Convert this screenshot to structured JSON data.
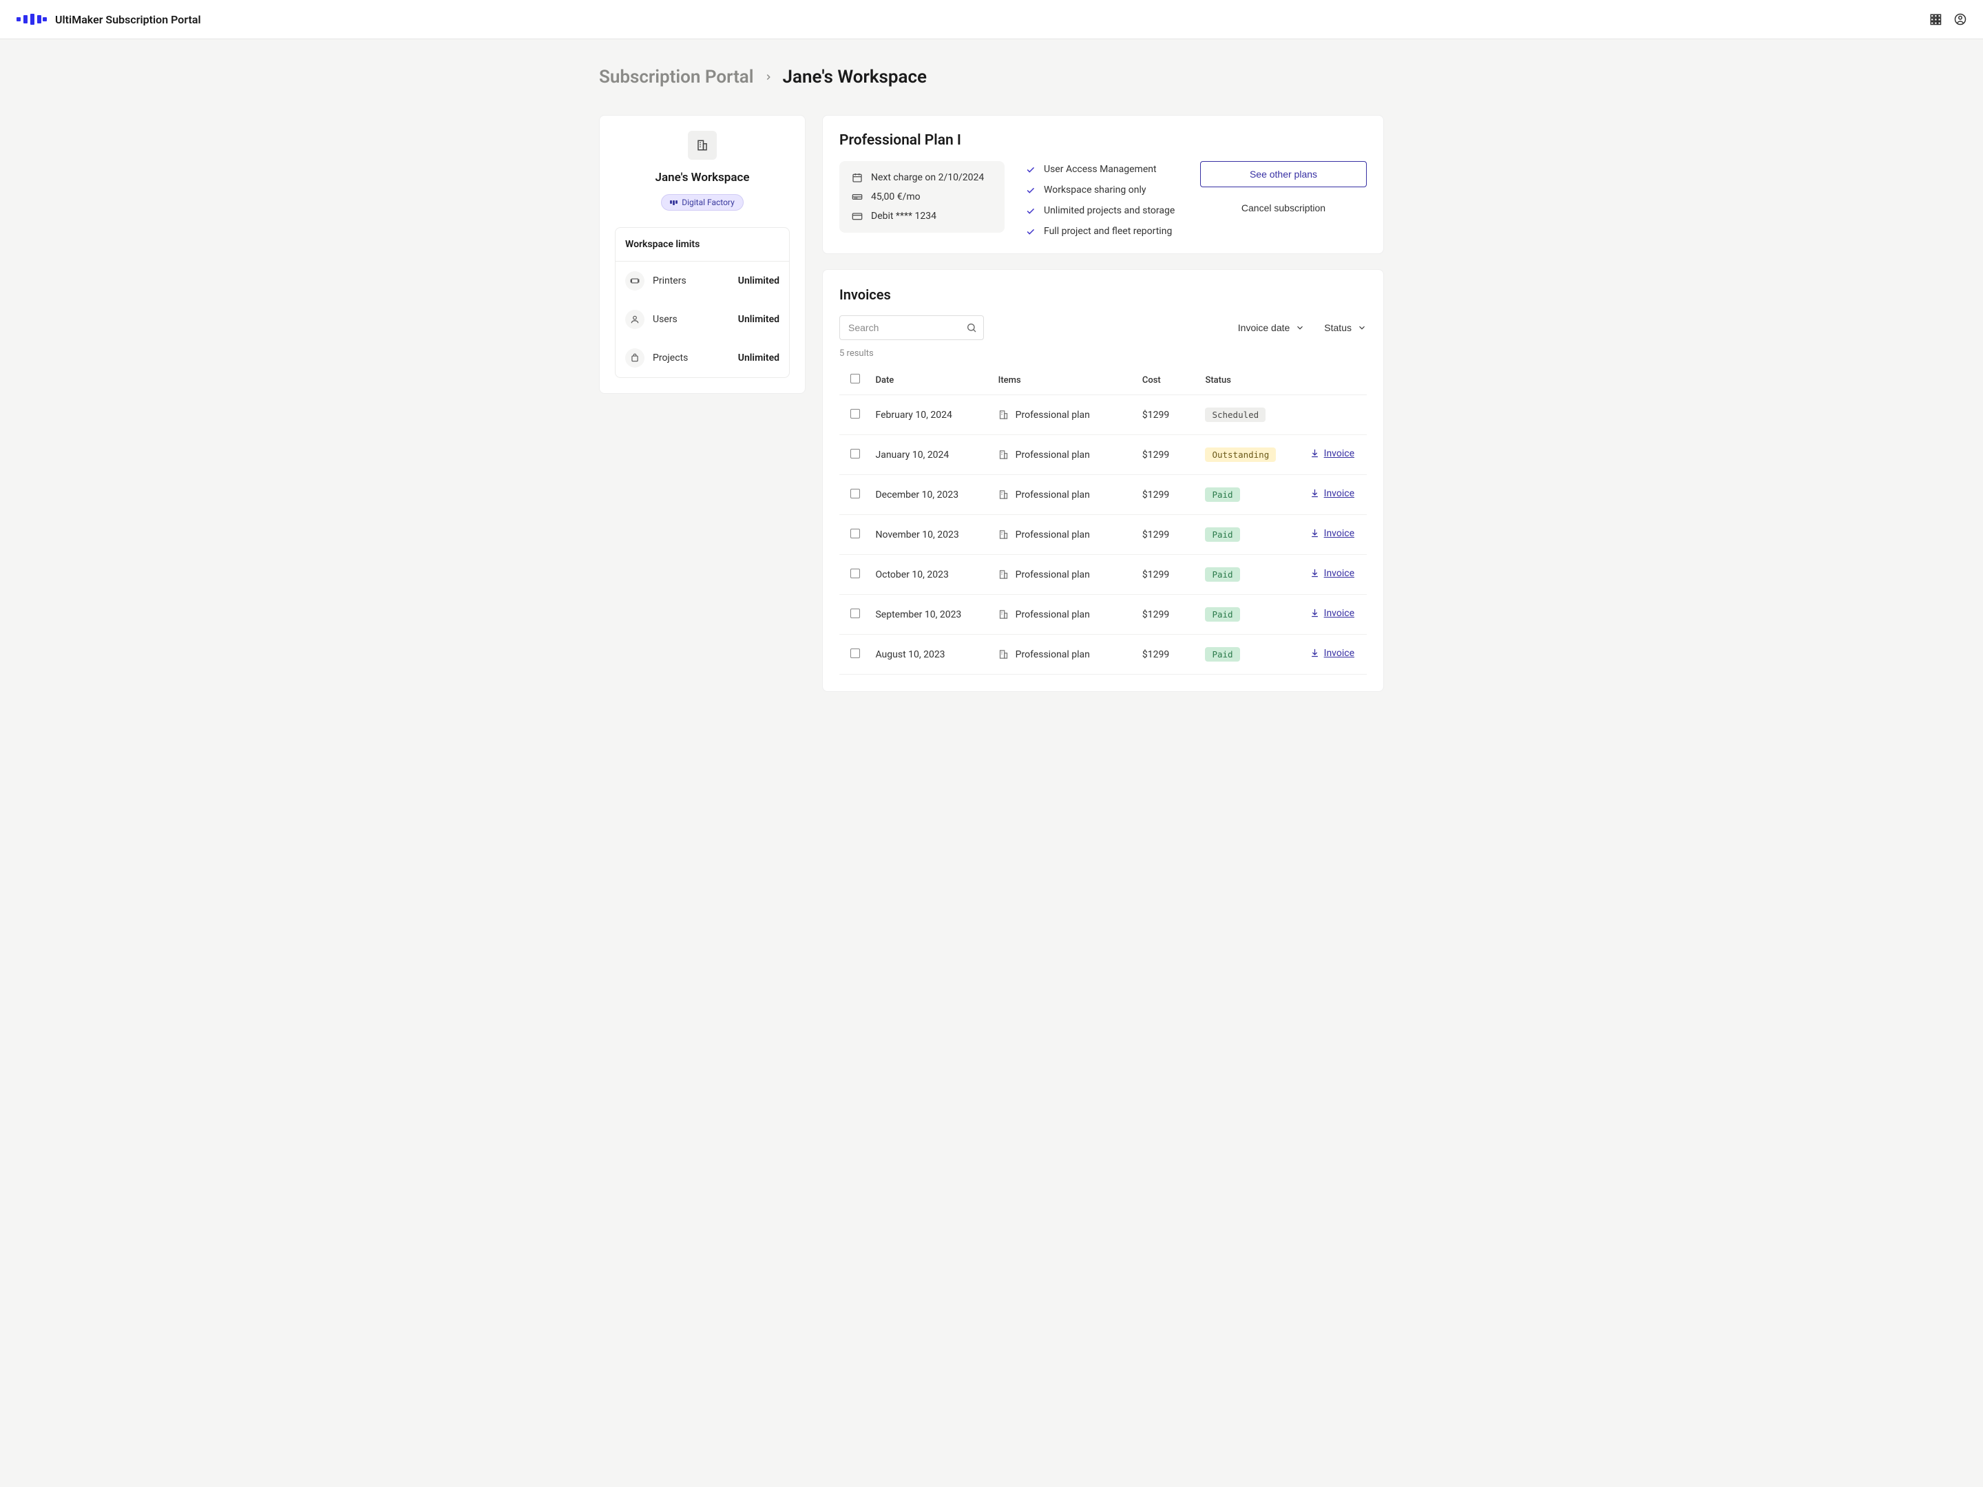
{
  "header": {
    "title": "UltiMaker Subscription Portal"
  },
  "breadcrumb": {
    "root": "Subscription Portal",
    "current": "Jane's Workspace"
  },
  "sidebar": {
    "workspace_name": "Jane's Workspace",
    "badge": "Digital Factory",
    "limits_title": "Workspace limits",
    "limits": [
      {
        "label": "Printers",
        "value": "Unlimited"
      },
      {
        "label": "Users",
        "value": "Unlimited"
      },
      {
        "label": "Projects",
        "value": "Unlimited"
      }
    ]
  },
  "plan": {
    "title": "Professional Plan I",
    "next_charge": "Next charge on 2/10/2024",
    "price": "45,00 €/mo",
    "payment": "Debit **** 1234",
    "features": [
      "User Access Management",
      "Workspace sharing only",
      "Unlimited projects and storage",
      "Full project and fleet reporting"
    ],
    "see_plans": "See other plans",
    "cancel": "Cancel subscription"
  },
  "invoices": {
    "title": "Invoices",
    "search_placeholder": "Search",
    "filter_date": "Invoice date",
    "filter_status": "Status",
    "results": "5 results",
    "headers": {
      "date": "Date",
      "items": "Items",
      "cost": "Cost",
      "status": "Status"
    },
    "link_label": "Invoice",
    "rows": [
      {
        "date": "February 10, 2024",
        "item": "Professional plan",
        "cost": "$1299",
        "status": "Scheduled",
        "status_kind": "scheduled",
        "link": false
      },
      {
        "date": "January 10, 2024",
        "item": "Professional plan",
        "cost": "$1299",
        "status": "Outstanding",
        "status_kind": "outstanding",
        "link": true
      },
      {
        "date": "December 10, 2023",
        "item": "Professional plan",
        "cost": "$1299",
        "status": "Paid",
        "status_kind": "paid",
        "link": true
      },
      {
        "date": "November 10, 2023",
        "item": "Professional plan",
        "cost": "$1299",
        "status": "Paid",
        "status_kind": "paid",
        "link": true
      },
      {
        "date": "October 10, 2023",
        "item": "Professional plan",
        "cost": "$1299",
        "status": "Paid",
        "status_kind": "paid",
        "link": true
      },
      {
        "date": "September 10, 2023",
        "item": "Professional plan",
        "cost": "$1299",
        "status": "Paid",
        "status_kind": "paid",
        "link": true
      },
      {
        "date": "August 10, 2023",
        "item": "Professional plan",
        "cost": "$1299",
        "status": "Paid",
        "status_kind": "paid",
        "link": true
      }
    ]
  }
}
